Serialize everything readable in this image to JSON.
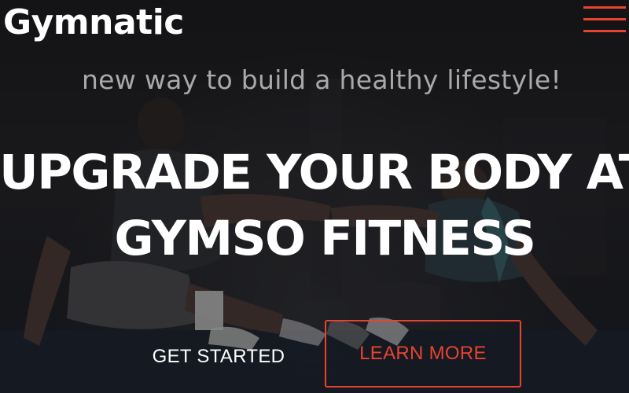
{
  "navbar": {
    "brand": "Gymnatic",
    "menu_icon": "hamburger-menu-icon"
  },
  "hero": {
    "subtitle": "new way to build a healthy lifestyle!",
    "headline_line1": "UPGRADE YOUR BODY AT",
    "headline_line2": "GYMSO FITNESS",
    "get_started_label": "GET STARTED",
    "learn_more_label": "LEARN MORE"
  },
  "colors": {
    "accent": "#e8432f",
    "text": "#ffffff",
    "subtitle": "#a9a9ab",
    "background": "#1b1b1d"
  }
}
